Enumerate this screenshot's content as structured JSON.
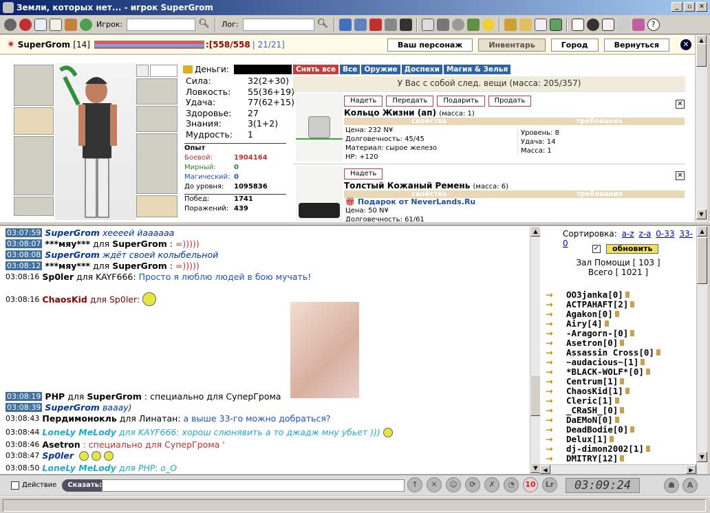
{
  "window": {
    "title": "Земли, которых нет... - игрок SuperGrom"
  },
  "toolbar": {
    "player_label": "Игрок:",
    "player_value": "",
    "log_label": "Лог:",
    "log_value": ""
  },
  "header": {
    "name": "SuperGrom",
    "level": "[14]",
    "hp": ":[558/558",
    "mp": "| 21/21]",
    "nav": [
      "Ваш персонаж",
      "Инвентарь",
      "Город",
      "Вернуться"
    ],
    "close": "✕"
  },
  "character": {
    "money_label": "Деньги:",
    "stats": [
      {
        "k": "Сила:",
        "v": "32",
        "extra": " (2+30)"
      },
      {
        "k": "Ловкость:",
        "v": "55",
        "extra": " (36+19)"
      },
      {
        "k": "Удача:",
        "v": "77",
        "extra": " (62+15)"
      },
      {
        "k": "Здоровье:",
        "v": "27",
        "extra": ""
      },
      {
        "k": "Знания:",
        "v": "3",
        "extra": " (1+2)"
      },
      {
        "k": "Мудрость:",
        "v": "1",
        "extra": ""
      }
    ],
    "exp_title": "Опыт",
    "exp": [
      {
        "k": "Боевой:",
        "v": "1904164",
        "c": "#c03030"
      },
      {
        "k": "Мирный:",
        "v": "0",
        "c": "#308030"
      },
      {
        "k": "Магический:",
        "v": "0",
        "c": "#2050a0"
      },
      {
        "k": "До уровня:",
        "v": "1095836",
        "c": "#000000"
      }
    ],
    "wins_label": "Побед:",
    "wins": "1741",
    "losses_label": "Поражений:",
    "losses": "439"
  },
  "inventory": {
    "tabs": [
      "Снять все",
      "Все",
      "Оружие",
      "Доспехи",
      "Магия & Зелья"
    ],
    "summary": "У Вас с собой след. вещи (масса: 205/357)",
    "props_label": "свойства",
    "req_label": "требования",
    "items": [
      {
        "buttons": [
          "Надеть",
          "Передать",
          "Подарить",
          "Продать"
        ],
        "name": "Кольцо Жизни (ап)",
        "mass": "(масса: 1)",
        "props": [
          "Цена: 232 N¥",
          "Долговечность: 45/45",
          "Материал: сырое железо",
          "HP: +120"
        ],
        "reqs": [
          "Уровень: 8",
          "Удача: 14",
          "Масса: 1"
        ]
      },
      {
        "buttons": [
          "Надеть"
        ],
        "name": "Толстый Кожаный Ремень",
        "mass": "(масса: 6)",
        "gift": "Подарок от NeverLands.Ru",
        "props": [
          "Цена: 50 N¥",
          "Долговечность: 61/61"
        ],
        "reqs": []
      }
    ]
  },
  "chat": {
    "messages": [
      {
        "ts": "03:07:59",
        "hl": true,
        "nick": "SuperGrom",
        "nc": "navy",
        "parts": [
          {
            "t": " хеееей йааааaa",
            "c": "t-navy"
          }
        ]
      },
      {
        "ts": "03:08:07",
        "hl": true,
        "nick": "***мяу***",
        "nc": "blue",
        "parts": [
          {
            "t": " для ",
            "c": ""
          },
          {
            "t": "SuperGrom",
            "c": "nick"
          },
          {
            "t": ": ",
            "c": ""
          },
          {
            "t": "=)))))",
            "c": "t-red"
          }
        ]
      },
      {
        "ts": "03:08:08",
        "hl": true,
        "nick": "SuperGrom",
        "nc": "navy",
        "parts": [
          {
            "t": " ждёт своей колыбельной",
            "c": "t-navy"
          }
        ]
      },
      {
        "ts": "03:08:12",
        "hl": true,
        "nick": "***мяу***",
        "nc": "blue",
        "parts": [
          {
            "t": " для ",
            "c": ""
          },
          {
            "t": "SuperGrom",
            "c": "nick"
          },
          {
            "t": ": ",
            "c": ""
          },
          {
            "t": "=)))))",
            "c": "t-red"
          }
        ]
      },
      {
        "ts": "03:08:16",
        "hl": false,
        "nick": "Sp0ler",
        "nc": "blue",
        "parts": [
          {
            "t": " для KAYF666: ",
            "c": ""
          },
          {
            "t": "Просто я люблю людей в бою мучать!",
            "c": "t-blue"
          }
        ]
      },
      {
        "ts": "03:08:16",
        "hl": false,
        "nick": "ChaosKid",
        "nc": "maroon",
        "parts": [
          {
            "t": " для Sp0ler:",
            "c": "t-maroon"
          }
        ]
      },
      {
        "ts": "03:08:19",
        "hl": true,
        "nick": "PHP",
        "nc": "blue",
        "parts": [
          {
            "t": " для ",
            "c": ""
          },
          {
            "t": "SuperGrom",
            "c": "nick"
          },
          {
            "t": ": специально для СуперГрома",
            "c": ""
          }
        ]
      },
      {
        "ts": "03:08:39",
        "hl": true,
        "nick": "SuperGrom",
        "nc": "navy",
        "parts": [
          {
            "t": " вaaay)",
            "c": "t-navy"
          }
        ]
      },
      {
        "ts": "03:08:43",
        "hl": false,
        "nick": "Пердимонокль",
        "nc": "blue",
        "parts": [
          {
            "t": " для Линатан: ",
            "c": ""
          },
          {
            "t": "а выше 33-го можно добраться?",
            "c": "t-blue"
          }
        ]
      },
      {
        "ts": "03:08:44",
        "hl": false,
        "nick": "LoneLy MeLody",
        "nc": "cyan",
        "parts": [
          {
            "t": " для KAYF666: хорош слюнявить ",
            "c": "t-cyan"
          },
          {
            "t": " а то джадж мну убьет )))",
            "c": "t-cyan"
          }
        ]
      },
      {
        "ts": "03:08:46",
        "hl": false,
        "nick": "Asetron",
        "nc": "blue",
        "parts": [
          {
            "t": ": специально для СуперГрома '",
            "c": "t-red"
          }
        ]
      },
      {
        "ts": "03:08:47",
        "hl": false,
        "nick": "Sp0ler",
        "nc": "navy",
        "parts": [
          {
            "t": "",
            "c": ""
          }
        ]
      },
      {
        "ts": "03:08:50",
        "hl": false,
        "nick": "LoneLy MeLody",
        "nc": "cyan",
        "parts": [
          {
            "t": " для PHP: o_O",
            "c": "t-cyan"
          }
        ]
      }
    ]
  },
  "users": {
    "sort_label": "Сортировка:",
    "sort_links": [
      "a-z",
      "z-a",
      "0-33",
      "33-0"
    ],
    "refresh": "обновить",
    "hall": "Зал Помощи [ 103 ]",
    "total": "Всего [ 1021 ]",
    "list": [
      "OO3janka[0]",
      "ACTPAHAFT[2]",
      "Agakon[0]",
      "Airy[4]",
      "-Aragorn-[0]",
      "Asetron[0]",
      "Assassin Cross[0]",
      "~audacious~[1]",
      "*BLACK-WOLF*[0]",
      "Centrum[1]",
      "ChaosKid[1]",
      "Cleric[1]",
      "_CRaSH_[0]",
      "DaEMoN[0]",
      "DeadBodie[0]",
      "Delux[1]",
      "dj-dimon2002[1]",
      "DMITRY[12]"
    ]
  },
  "bottom": {
    "action_label": "Действие",
    "say_label": "Сказать:",
    "say_value": "",
    "clock": "03:09:24",
    "badge": "10"
  }
}
